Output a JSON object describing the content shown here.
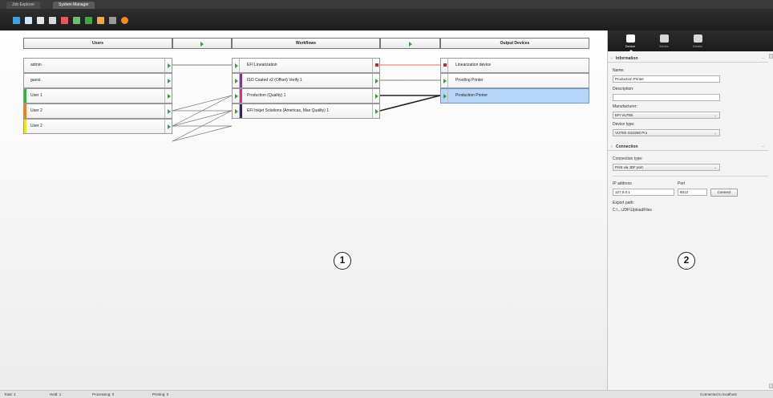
{
  "tabs": [
    {
      "label": "Job Explorer"
    },
    {
      "label": "System Manager"
    }
  ],
  "toolbar": {
    "icons": [
      {
        "name": "add-connection-icon",
        "color": "#3fa0e0"
      },
      {
        "name": "edit-icon",
        "color": "#cfe6ff"
      },
      {
        "name": "printer-icon",
        "color": "#e5e5e5"
      },
      {
        "name": "layout-icon",
        "color": "#d9d9d9"
      },
      {
        "name": "remove-icon",
        "color": "#e25b5b"
      },
      {
        "name": "import-icon",
        "color": "#6cbf6c"
      },
      {
        "name": "export-icon",
        "color": "#41a54a"
      },
      {
        "name": "report-icon",
        "color": "#f2a540"
      },
      {
        "name": "calibrate-icon",
        "color": "#9a9a9a"
      },
      {
        "name": "stop-icon",
        "color": "#f28a1c"
      }
    ]
  },
  "columns": {
    "users": "Users",
    "workflows": "Workflows",
    "output_devices": "Output Devices"
  },
  "users": [
    {
      "label": "admin",
      "color": ""
    },
    {
      "label": "guest",
      "color": ""
    },
    {
      "label": "User 1",
      "color": "#33b24a"
    },
    {
      "label": "User 2",
      "color": "#f07f1d"
    },
    {
      "label": "User 2",
      "color": "#f4e51c"
    }
  ],
  "workflows": [
    {
      "label": "EFI Linearization",
      "color": "",
      "status": "stop"
    },
    {
      "label": "ISO Coated v2 (Offset) Verify 1",
      "color": "#a01db5",
      "status": "play"
    },
    {
      "label": "Production (Quality) 1",
      "color": "#e02a9c",
      "status": "play"
    },
    {
      "label": "EFI Inkjet Solutions (Americas, Max Quality) 1",
      "color": "#3b1a8f",
      "status": "play"
    }
  ],
  "devices": [
    {
      "label": "Linearization device",
      "status": "stop"
    },
    {
      "label": "Proofing Printer",
      "status": "play"
    },
    {
      "label": "Production Printer",
      "status": "play"
    }
  ],
  "callouts": {
    "one": "1",
    "two": "2"
  },
  "panel": {
    "tabs": [
      {
        "label": "Device"
      },
      {
        "label": "Media"
      },
      {
        "label": "Details"
      }
    ],
    "information": {
      "title": "Information",
      "name_label": "Name:",
      "name_value": "Production Printer",
      "description_label": "Description:",
      "description_value": "",
      "manufacturer_label": "Manufacturer:",
      "manufacturer_value": "EFI VUTEk",
      "device_type_label": "Device type:",
      "device_type_value": "VUTEk GS3250 Pro"
    },
    "connection": {
      "title": "Connection",
      "type_label": "Connection type:",
      "type_value": "Print via JDF port",
      "ip_label": "IP address",
      "ip_value": "127.0.0.1",
      "port_label": "Port",
      "port_value": "8013",
      "connect_button": "Connect",
      "export_label": "Export path:",
      "export_value": "C:\\...\\JDF\\UploadFiles"
    }
  },
  "statusbar": {
    "total": "Total: 1",
    "held": "Held: 1",
    "processing": "Processing: 0",
    "printing": "Printing: 0",
    "connection": "Connected to localhost"
  }
}
